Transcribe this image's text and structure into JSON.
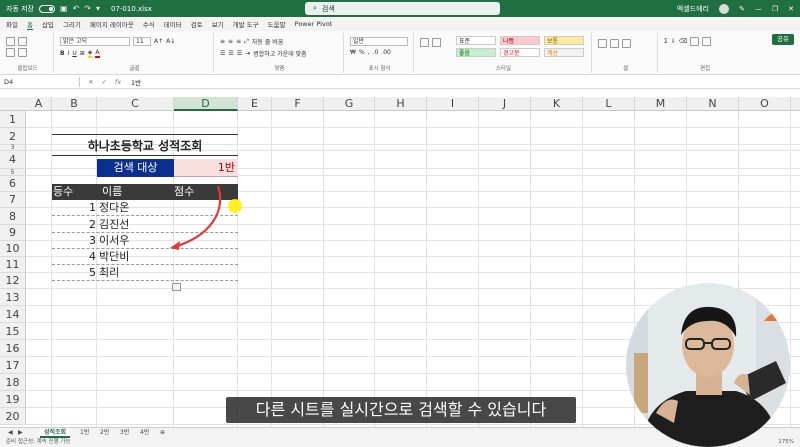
{
  "titlebar": {
    "autosave": "자동 저장",
    "filename": "07-010.xlsx",
    "search_placeholder": "검색",
    "user": "엑셀드에리"
  },
  "menu": [
    "파일",
    "홈",
    "삽입",
    "그리기",
    "페이지 레이아웃",
    "수식",
    "데이터",
    "검토",
    "보기",
    "개발 도구",
    "도움말",
    "Power Pivot"
  ],
  "ribbon": {
    "font_name": "맑은 고딕",
    "font_size": "11",
    "number_format": "일반",
    "styles": [
      {
        "label": "표준",
        "bg": "#ffffff",
        "color": "#333333"
      },
      {
        "label": "나쁨",
        "bg": "#ffc7ce",
        "color": "#9c0006"
      },
      {
        "label": "보통",
        "bg": "#ffeb9c",
        "color": "#9c5700"
      },
      {
        "label": "좋음",
        "bg": "#c6efce",
        "color": "#006100"
      },
      {
        "label": "경고문",
        "bg": "#ffffff",
        "color": "#ff0000"
      },
      {
        "label": "계산",
        "bg": "#f2f2f2",
        "color": "#fa7d00"
      }
    ],
    "groups": [
      "클립보드",
      "글꼴",
      "맞춤",
      "표시 형식",
      "스타일",
      "셀",
      "편집"
    ],
    "share": "공유",
    "wrap_text": "자동 줄 바꿈",
    "merge": "병합하고 가운데 맞춤"
  },
  "formula": {
    "namebox": "D4",
    "fx": "fx",
    "value": "1반"
  },
  "columns": [
    "A",
    "B",
    "C",
    "D",
    "E",
    "F",
    "G",
    "H",
    "I",
    "J",
    "K",
    "L",
    "M",
    "N",
    "O"
  ],
  "rows": [
    "1",
    "2",
    "3",
    "4",
    "5",
    "6",
    "7",
    "8",
    "9",
    "10",
    "11",
    "12",
    "13",
    "14",
    "15",
    "16",
    "17",
    "18",
    "19",
    "20"
  ],
  "sheet": {
    "title": "하나초등학교 성적조회",
    "search_label": "검색 대상",
    "search_value": "1반",
    "headers": [
      "등수",
      "이름",
      "점수"
    ],
    "records": [
      {
        "rank": "1",
        "name": "정다온"
      },
      {
        "rank": "2",
        "name": "김진선"
      },
      {
        "rank": "3",
        "name": "이서우"
      },
      {
        "rank": "4",
        "name": "박단비"
      },
      {
        "rank": "5",
        "name": "최리"
      }
    ]
  },
  "tabs": [
    "성적조회",
    "1반",
    "2반",
    "3반",
    "4반"
  ],
  "status": {
    "left": "준비   접근성: 계속 진행 가능",
    "zoom": "175%"
  },
  "caption": "다른 시트를 실시간으로 검색할 수 있습니다",
  "colors": {
    "excel_green": "#1f6f43",
    "search_label_bg": "#0b2f8c",
    "search_value_bg": "#f9dede",
    "arrow": "#e03a3a",
    "header_bg": "#3a3a3a"
  }
}
